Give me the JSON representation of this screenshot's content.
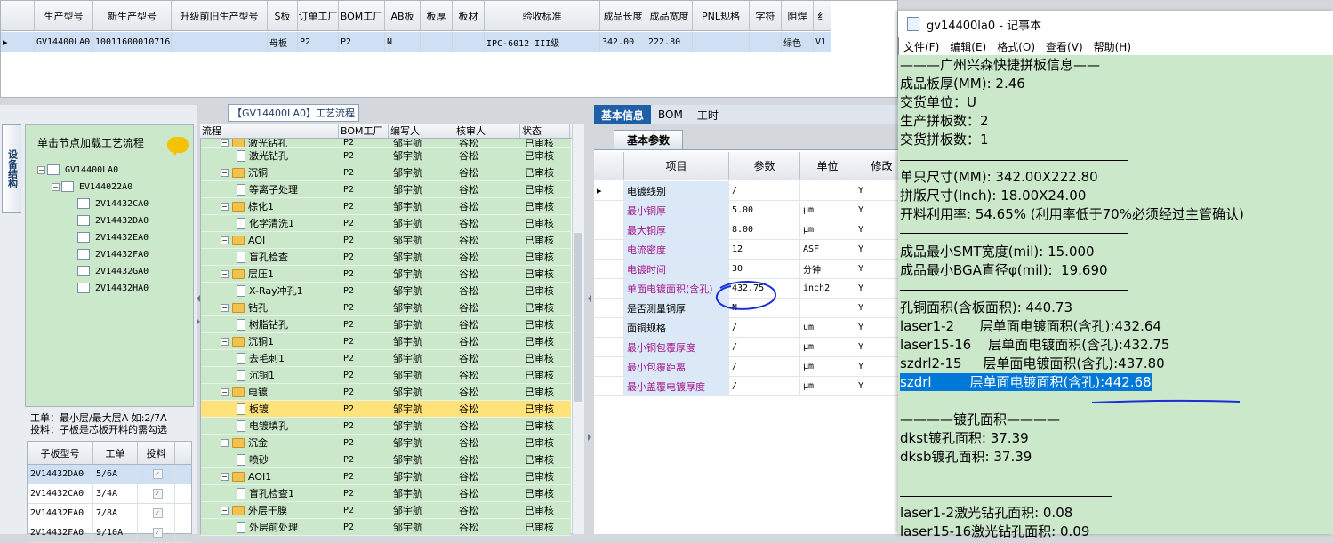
{
  "top_grid": {
    "headers": [
      "生产型号",
      "新生产型号",
      "升级前旧生产型号",
      "S板",
      "订单工厂",
      "BOM工厂",
      "AB板",
      "板厚",
      "板材",
      "验收标准",
      "成品长度",
      "成品宽度",
      "PNL规格",
      "字符",
      "阻焊",
      "纟"
    ],
    "row": [
      "GV14400LA0",
      "10011600010716",
      "",
      "母板",
      "P2",
      "P2",
      "N",
      "",
      "",
      "IPC-6012 III级",
      "342.00",
      "222.80",
      "",
      "",
      "绿色",
      "V1"
    ]
  },
  "left": {
    "vtab_label": "设备结构",
    "tree_header": "单击节点加载工艺流程",
    "tree": [
      "GV14400LA0",
      "EV144022A0",
      "2V14432CA0",
      "2V14432DA0",
      "2V14432EA0",
      "2V14432FA0",
      "2V14432GA0",
      "2V14432HA0"
    ],
    "info_line1": "工单：最小层/最大层A 如:2/7A",
    "info_line2": "投料：子板是芯板开料的需勾选",
    "sub_headers": [
      "子板型号",
      "工单",
      "投料"
    ],
    "sub_rows": [
      {
        "model": "2V14432DA0",
        "order": "5/6A"
      },
      {
        "model": "2V14432CA0",
        "order": "3/4A"
      },
      {
        "model": "2V14432EA0",
        "order": "7/8A"
      },
      {
        "model": "2V14432FA0",
        "order": "9/10A"
      }
    ]
  },
  "flow": {
    "title": "【GV14400LA0】工艺流程",
    "headers": [
      "流程",
      "BOM工厂",
      "编写人",
      "核审人",
      "状态"
    ],
    "rows": [
      {
        "name": "激光钻孔",
        "type": "folder",
        "bom": "P2",
        "editor": "邹宇航",
        "reviewer": "谷松",
        "status": "已审核"
      },
      {
        "name": "激光钻孔",
        "type": "doc",
        "bom": "P2",
        "editor": "邹宇航",
        "reviewer": "谷松",
        "status": "已审核"
      },
      {
        "name": "沉铜",
        "type": "folder",
        "bom": "P2",
        "editor": "邹宇航",
        "reviewer": "谷松",
        "status": "已审核"
      },
      {
        "name": "等离子处理",
        "type": "doc",
        "bom": "P2",
        "editor": "邹宇航",
        "reviewer": "谷松",
        "status": "已审核"
      },
      {
        "name": "棕化1",
        "type": "folder",
        "bom": "P2",
        "editor": "邹宇航",
        "reviewer": "谷松",
        "status": "已审核"
      },
      {
        "name": "化学清洗1",
        "type": "doc",
        "bom": "P2",
        "editor": "邹宇航",
        "reviewer": "谷松",
        "status": "已审核"
      },
      {
        "name": "AOI",
        "type": "folder",
        "bom": "P2",
        "editor": "邹宇航",
        "reviewer": "谷松",
        "status": "已审核"
      },
      {
        "name": "盲孔检查",
        "type": "doc",
        "bom": "P2",
        "editor": "邹宇航",
        "reviewer": "谷松",
        "status": "已审核"
      },
      {
        "name": "层压1",
        "type": "folder",
        "bom": "P2",
        "editor": "邹宇航",
        "reviewer": "谷松",
        "status": "已审核"
      },
      {
        "name": "X-Ray冲孔1",
        "type": "doc",
        "bom": "P2",
        "editor": "邹宇航",
        "reviewer": "谷松",
        "status": "已审核"
      },
      {
        "name": "钻孔",
        "type": "folder",
        "bom": "P2",
        "editor": "邹宇航",
        "reviewer": "谷松",
        "status": "已审核"
      },
      {
        "name": "树脂钻孔",
        "type": "doc",
        "bom": "P2",
        "editor": "邹宇航",
        "reviewer": "谷松",
        "status": "已审核"
      },
      {
        "name": "沉铜1",
        "type": "folder",
        "bom": "P2",
        "editor": "邹宇航",
        "reviewer": "谷松",
        "status": "已审核"
      },
      {
        "name": "去毛刺1",
        "type": "doc",
        "bom": "P2",
        "editor": "邹宇航",
        "reviewer": "谷松",
        "status": "已审核"
      },
      {
        "name": "沉铜1",
        "type": "doc",
        "bom": "P2",
        "editor": "邹宇航",
        "reviewer": "谷松",
        "status": "已审核"
      },
      {
        "name": "电镀",
        "type": "folder",
        "bom": "P2",
        "editor": "邹宇航",
        "reviewer": "谷松",
        "status": "已审核"
      },
      {
        "name": "板镀",
        "type": "doc",
        "bom": "P2",
        "editor": "邹宇航",
        "reviewer": "谷松",
        "status": "已审核",
        "selected": true
      },
      {
        "name": "电镀填孔",
        "type": "doc",
        "bom": "P2",
        "editor": "邹宇航",
        "reviewer": "谷松",
        "status": "已审核"
      },
      {
        "name": "沉金",
        "type": "folder",
        "bom": "P2",
        "editor": "邹宇航",
        "reviewer": "谷松",
        "status": "已审核"
      },
      {
        "name": "喷砂",
        "type": "doc",
        "bom": "P2",
        "editor": "邹宇航",
        "reviewer": "谷松",
        "status": "已审核"
      },
      {
        "name": "AOI1",
        "type": "folder",
        "bom": "P2",
        "editor": "邹宇航",
        "reviewer": "谷松",
        "status": "已审核"
      },
      {
        "name": "盲孔检查1",
        "type": "doc",
        "bom": "P2",
        "editor": "邹宇航",
        "reviewer": "谷松",
        "status": "已审核"
      },
      {
        "name": "外层干膜",
        "type": "folder",
        "bom": "P2",
        "editor": "邹宇航",
        "reviewer": "谷松",
        "status": "已审核"
      },
      {
        "name": "外层前处理",
        "type": "doc",
        "bom": "P2",
        "editor": "邹宇航",
        "reviewer": "谷松",
        "status": "已审核"
      }
    ]
  },
  "basic": {
    "tabs": [
      "基本信息",
      "BOM",
      "工时"
    ],
    "sub_tab": "基本参数",
    "headers": [
      "项目",
      "参数",
      "单位",
      "修改"
    ],
    "rows": [
      {
        "item": "电镀线别",
        "value": "/",
        "unit": "",
        "mod": "Y",
        "red": false
      },
      {
        "item": "最小铜厚",
        "value": "5.00",
        "unit": "μm",
        "mod": "Y",
        "red": true
      },
      {
        "item": "最大铜厚",
        "value": "8.00",
        "unit": "μm",
        "mod": "Y",
        "red": true
      },
      {
        "item": "电流密度",
        "value": "12",
        "unit": "ASF",
        "mod": "Y",
        "red": true
      },
      {
        "item": "电镀时间",
        "value": "30",
        "unit": "分钟",
        "mod": "Y",
        "red": true
      },
      {
        "item": "单面电镀面积(含孔)",
        "value": "432.75",
        "unit": "inch2",
        "mod": "Y",
        "red": true
      },
      {
        "item": "是否测量铜厚",
        "value": "N",
        "unit": "",
        "mod": "Y",
        "red": false
      },
      {
        "item": "面铜规格",
        "value": "/",
        "unit": "um",
        "mod": "Y",
        "red": false
      },
      {
        "item": "最小铜包覆厚度",
        "value": "/",
        "unit": "μm",
        "mod": "Y",
        "red": true
      },
      {
        "item": "最小包覆距离",
        "value": "/",
        "unit": "μm",
        "mod": "Y",
        "red": true
      },
      {
        "item": "最小盖覆电镀厚度",
        "value": "/",
        "unit": "μm",
        "mod": "Y",
        "red": true
      }
    ]
  },
  "notepad": {
    "title": "gv14400la0 - 记事本",
    "menu": [
      "文件(F)",
      "编辑(E)",
      "格式(O)",
      "查看(V)",
      "帮助(H)"
    ],
    "lines": [
      "———广州兴森快捷拼板信息——",
      "成品板厚(MM): 2.46",
      "交货单位：U",
      "生产拼板数：2",
      "交货拼板数：1",
      "",
      "单只尺寸(MM): 342.00X222.80",
      "拼版尺寸(Inch): 18.00X24.00",
      "开料利用率: 54.65% (利用率低于70%必须经过主管确认)",
      "",
      "成品最小SMT宽度(mil): 15.000",
      "成品最小BGA直径φ(mil):  19.690",
      "",
      "孔铜面积(含板面积): 440.73",
      "laser1-2      层单面电镀面积(含孔):432.64",
      "laser15-16    层单面电镀面积(含孔):432.75",
      "szdrl2-15     层单面电镀面积(含孔):437.80",
      "szdrl         层单面电镀面积(含孔):442.68",
      "",
      "————镀孔面积————",
      "dkst镀孔面积: 37.39",
      "dksb镀孔面积: 37.39",
      "",
      "",
      "laser1-2激光钻孔面积: 0.08",
      "laser15-16激光钻孔面积: 0.09"
    ]
  },
  "colors": {
    "green_bg": "#cbe8cb",
    "selected_row": "#ffe27a",
    "highlight": "#0078d7",
    "tab_active": "#1f5fa8",
    "annotation": "#1a2fd6"
  }
}
